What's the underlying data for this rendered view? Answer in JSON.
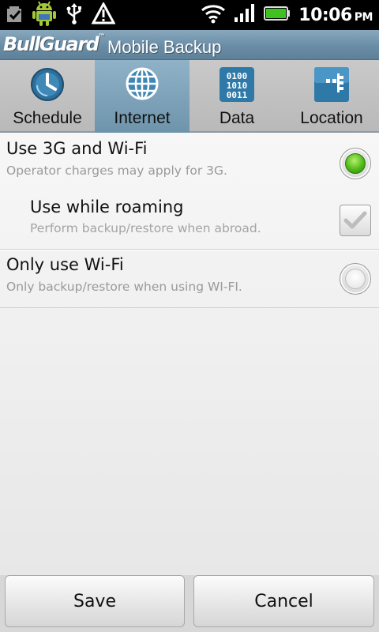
{
  "status_bar": {
    "time": "10:06",
    "ampm": "PM",
    "left_icons": [
      "checkbox-notification-icon",
      "android-icon",
      "usb-icon",
      "warning-icon"
    ],
    "right_icons": [
      "wifi-icon",
      "signal-icon",
      "battery-icon"
    ],
    "battery_level": 1.0
  },
  "header": {
    "brand": "BullGuard",
    "trademark": "™",
    "title": "Mobile Backup"
  },
  "tabs": [
    {
      "label": "Schedule",
      "icon": "clock-icon",
      "active": false
    },
    {
      "label": "Internet",
      "icon": "globe-icon",
      "active": true
    },
    {
      "label": "Data",
      "icon": "binary-data-icon",
      "active": false
    },
    {
      "label": "Location",
      "icon": "location-icon",
      "active": false
    }
  ],
  "options": [
    {
      "title": "Use 3G and Wi-Fi",
      "subtitle": "Operator charges may apply for 3G.",
      "control": "radio",
      "checked": true
    },
    {
      "title": "Use while roaming",
      "subtitle": "Perform backup/restore when abroad.",
      "control": "checkbox",
      "checked": true,
      "enabled": false
    },
    {
      "title": "Only use Wi-Fi",
      "subtitle": "Only backup/restore when using WI-FI.",
      "control": "radio",
      "checked": false
    }
  ],
  "buttons": {
    "save": "Save",
    "cancel": "Cancel"
  },
  "colors": {
    "accent_selected": "#49b414",
    "title_bar": "#6a8da6",
    "active_tab": "#7fa3ba"
  }
}
